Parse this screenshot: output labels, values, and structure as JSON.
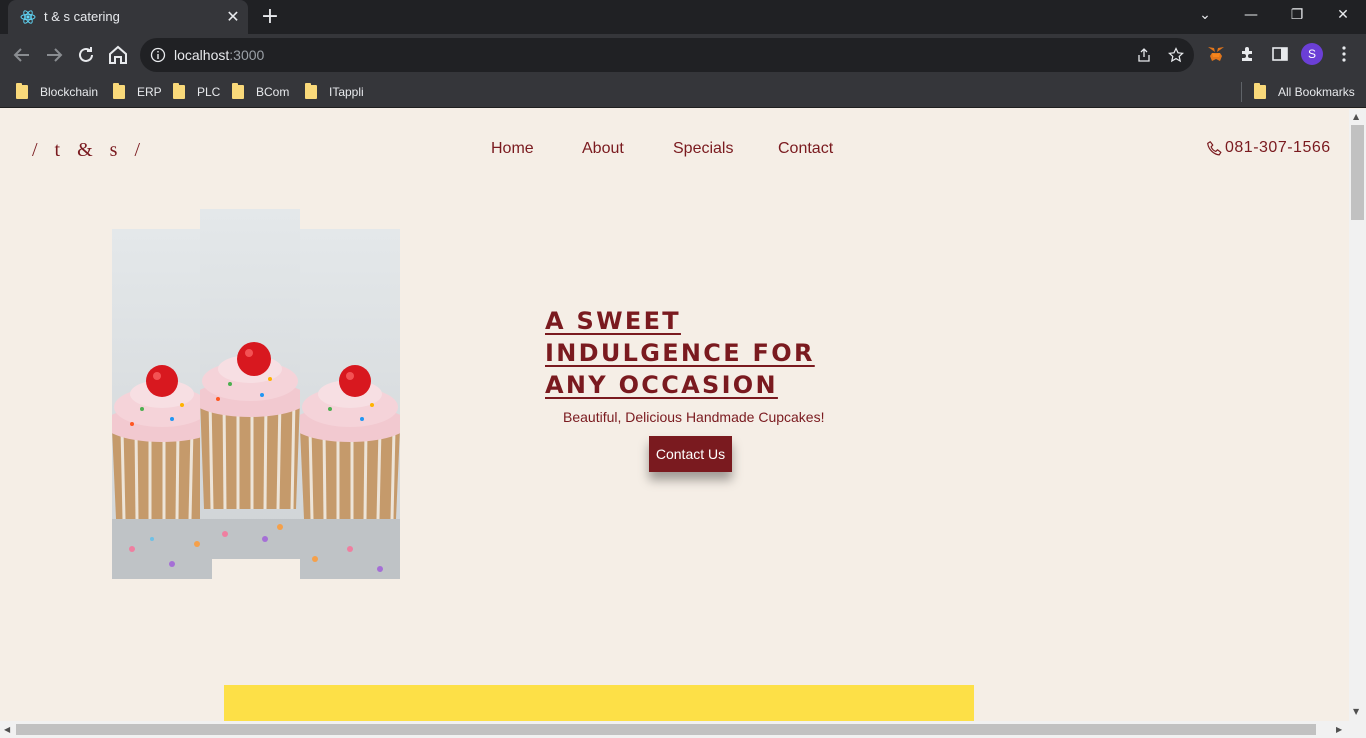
{
  "browser": {
    "tab_title": "t & s catering",
    "url_host": "localhost",
    "url_port": ":3000",
    "profile_initial": "S",
    "bookmarks": [
      "Blockchain",
      "ERP",
      "PLC",
      "BCom",
      "ITappli"
    ],
    "all_bookmarks": "All Bookmarks"
  },
  "site": {
    "brand": "/ t & s /",
    "nav": [
      "Home",
      "About",
      "Specials",
      "Contact"
    ],
    "phone": "081-307-1566",
    "hero": {
      "title": "A SWEET INDULGENCE FOR ANY OCCASION",
      "subtitle": "Beautiful, Delicious Handmade Cupcakes!",
      "cta": "Contact Us"
    }
  },
  "colors": {
    "page_bg": "#f5eee6",
    "accent": "#7a1a1f",
    "band": "#fde047"
  }
}
